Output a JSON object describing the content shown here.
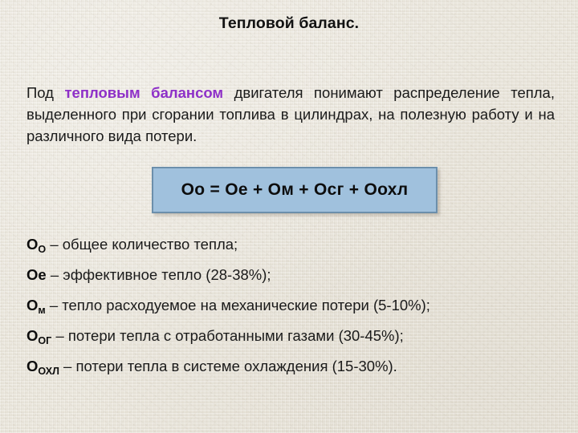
{
  "slide": {
    "title": "Тепловой баланс.",
    "background_color": "#e9e5db"
  },
  "intro": {
    "before": "Под ",
    "accent": "тепловым балансом",
    "after": " двигателя понимают распределение тепла, выделенного при сгорании топлива в цилиндрах, на полезную работу и на различного вида потери.",
    "accent_color": "#8e30c8"
  },
  "formula": {
    "text": "Оо = Ое + Ом + Осг + Оохл",
    "fill_color": "#a0c1dd",
    "border_color": "#6c8fab"
  },
  "legend": {
    "items": [
      {
        "symbol": "О",
        "subscript": "О",
        "dash": " – ",
        "description": "общее количество тепла;"
      },
      {
        "symbol": "Ое",
        "subscript": "",
        "dash": " – ",
        "description": "эффективное тепло (28-38%);"
      },
      {
        "symbol": "О",
        "subscript": "м",
        "dash": " – ",
        "description": "тепло расходуемое на механические потери (5-10%);"
      },
      {
        "symbol": "О",
        "subscript": "ОГ",
        "dash": " – ",
        "description": "потери тепла с отработанными газами (30-45%);"
      },
      {
        "symbol": "О",
        "subscript": "ОХЛ",
        "dash": " – ",
        "description": "потери тепла в системе охлаждения (15-30%)."
      }
    ]
  }
}
